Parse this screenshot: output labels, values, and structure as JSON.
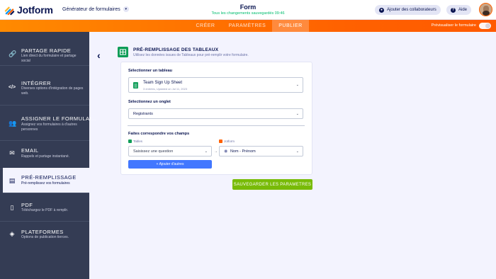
{
  "app": {
    "brand": "Jotform",
    "builder_label": "Générateur de formulaires",
    "form_title": "Form",
    "saved_status": "Tous les changements sauvegardés 09:46"
  },
  "header": {
    "collab_label": "Ajouter des collaborateurs",
    "help_label": "Aide"
  },
  "nav": {
    "tabs": [
      {
        "label": "CRÉER"
      },
      {
        "label": "PARAMÈTRES"
      },
      {
        "label": "PUBLIER"
      }
    ],
    "active": "PUBLIER",
    "preview_label": "Prévisualiser le formulaire"
  },
  "sidebar": {
    "items": [
      {
        "title": "PARTAGE RAPIDE",
        "desc": "Lien direct du formulaire et partage social",
        "icon": "link-icon"
      },
      {
        "title": "INTÉGRER",
        "desc": "Diverses options d'intégration de pages web.",
        "icon": "code-icon"
      },
      {
        "title": "ASSIGNER LE FORMULAI...",
        "desc": "Assignez vos formulaires à d'autres personnes",
        "icon": "users-icon"
      },
      {
        "title": "EMAIL",
        "desc": "Rappels et partage instantané.",
        "icon": "envelope-icon"
      },
      {
        "title": "PRÉ-REMPLISSAGE",
        "desc": "Pré-remplissez vos formulaires",
        "icon": "prefill-icon"
      },
      {
        "title": "PDF",
        "desc": "Téléchargez le PDF à remplir.",
        "icon": "pdf-icon"
      },
      {
        "title": "PLATEFORMES",
        "desc": "Options de publication tierces.",
        "icon": "layers-icon"
      }
    ]
  },
  "panel": {
    "title": "PRÉ-REMPLISSAGE DES TABLEAUX",
    "subtitle": "Utilisez les données issues de Tableaux pour pré-remplir votre formulaire.",
    "table_label": "Sélectionner un tableau",
    "table_name": "Team Sign Up Sheet",
    "table_meta": "3 entrées, Updated on Jul 11, 2023",
    "tab_label": "Sélectionnez un onglet",
    "tab_value": "Registrants",
    "match_label": "Faites correspondre vos champs",
    "col_tables": "Tables",
    "col_jotform": "Jotform",
    "question_placeholder": "Saisissez une question",
    "field_value": "Nom - Prénom",
    "add_button": "+ Ajouter d'autres",
    "save_button": "SAUVEGARDER LES PARAMETRES"
  },
  "colors": {
    "accent": "#ff6100",
    "sidebar": "#343c54",
    "save": "#78bb07",
    "add": "#4277ff",
    "sheets": "#0f9d58"
  }
}
